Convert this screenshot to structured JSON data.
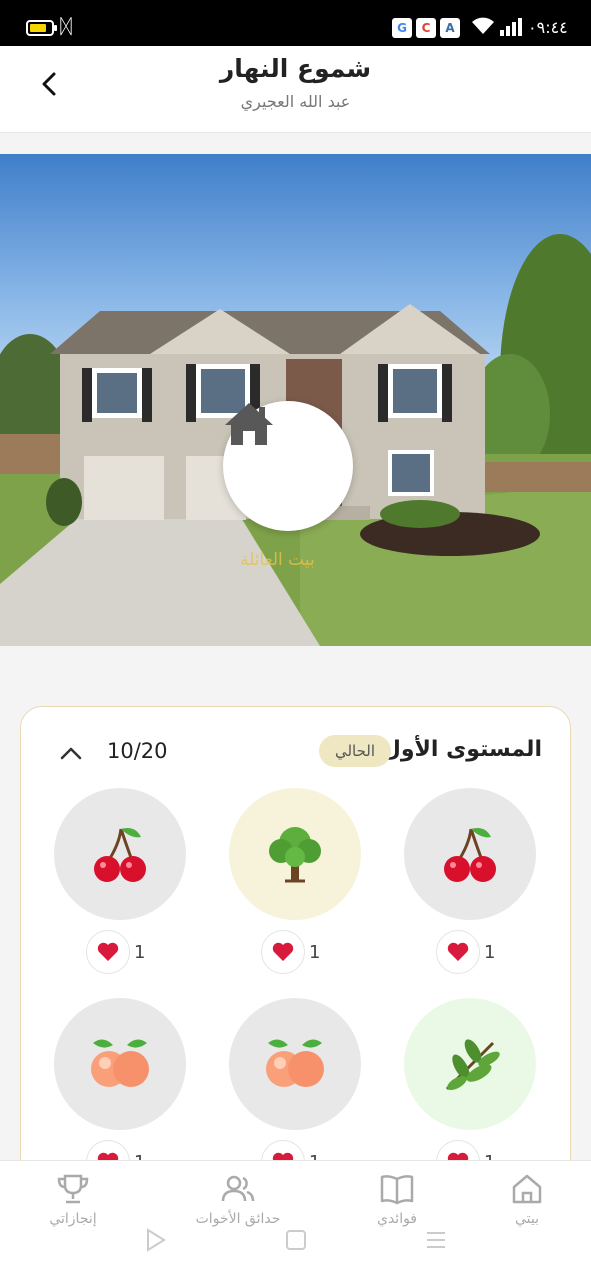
{
  "status_bar": {
    "time": "٠٩:٤٤",
    "app_icons": [
      "G",
      "C",
      "A"
    ],
    "battery_color": "#f5d400"
  },
  "header": {
    "title": "شموع النهار",
    "subtitle": "عبد الله العجيري",
    "back_icon": "chevron-left-icon"
  },
  "hero": {
    "center_icon": "home-icon",
    "caption": "بيت العائلة"
  },
  "level": {
    "title": "المستوى الأول",
    "badge": "الحالي",
    "progress": "10/20",
    "collapse_icon": "chevron-up-icon",
    "items": [
      {
        "emoji": "🍒",
        "name": "cherries",
        "likes": "1",
        "bg": "#e8e8e8"
      },
      {
        "emoji": "🌳",
        "name": "tree",
        "likes": "1",
        "bg": "#f6f3da"
      },
      {
        "emoji": "🍒",
        "name": "cherries",
        "likes": "1",
        "bg": "#e8e8e8"
      },
      {
        "emoji": "🌿",
        "name": "herb",
        "likes": "1",
        "bg": "#eaf9e6"
      },
      {
        "emoji": "🍑",
        "name": "peach",
        "likes": "1",
        "bg": "#e8e8e8"
      },
      {
        "emoji": "🍑",
        "name": "peach",
        "likes": "1",
        "bg": "#e8e8e8"
      }
    ]
  },
  "bottom_nav": {
    "items": [
      {
        "label": "بيتي",
        "icon": "home-icon"
      },
      {
        "label": "فوائدي",
        "icon": "book-icon"
      },
      {
        "label": "حدائق الأخوات",
        "icon": "users-icon"
      },
      {
        "label": "إنجازاتي",
        "icon": "trophy-icon"
      }
    ]
  },
  "colors": {
    "accent_border": "#e8d9b2",
    "badge_bg": "#efe6c2",
    "heart": "#d81b3c"
  }
}
